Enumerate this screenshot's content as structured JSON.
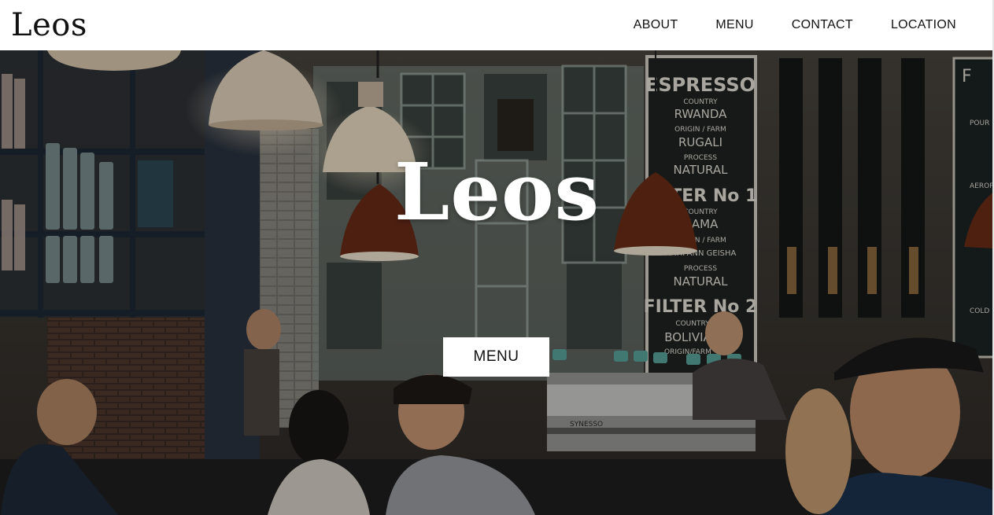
{
  "brand": "Leos",
  "nav": {
    "items": [
      "ABOUT",
      "MENU",
      "CONTACT",
      "LOCATION"
    ]
  },
  "hero": {
    "title": "Leos",
    "button_label": "MENU",
    "chalkboard": {
      "heading": "ESPRESSO",
      "lines": [
        "COUNTRY",
        "RWANDA",
        "ORIGIN / FARM",
        "RUGALI",
        "PROCESS",
        "NATURAL",
        "FILTER No 1",
        "COUNTRY",
        "NAMA",
        "ORIGIN / FARM",
        "HATIPANN GEISHA",
        "PROCESS",
        "NATURAL",
        "FILTER No 2",
        "COUNTRY",
        "BOLIVIA",
        "ORIGIN/FARM"
      ]
    },
    "right_board": {
      "lines": [
        "F",
        "POUR",
        "AEROP",
        "COLD"
      ]
    },
    "machine_brand": "SYNESSO"
  },
  "colors": {
    "nav_bg": "#ffffff",
    "text_dark": "#111111",
    "hero_text": "#ffffff",
    "button_bg": "#ffffff",
    "chalk": "#e9e6dc"
  }
}
